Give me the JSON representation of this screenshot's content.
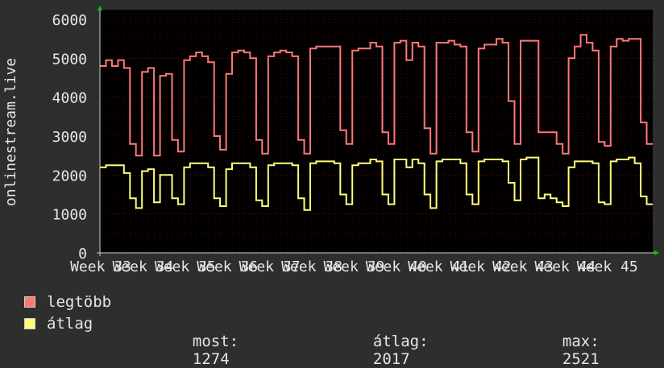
{
  "chart_data": {
    "type": "line",
    "ylabel": "onlinestream.live",
    "ylim": [
      0,
      6000
    ],
    "yticks": [
      0,
      1000,
      2000,
      3000,
      4000,
      5000,
      6000
    ],
    "xtick_labels": [
      "Week 33",
      "Week 34",
      "Week 35",
      "Week 36",
      "Week 37",
      "Week 38",
      "Week 39",
      "Week 40",
      "Week 41",
      "Week 42",
      "Week 43",
      "Week 44",
      "Week 45"
    ],
    "grid": true,
    "x_unit": "day",
    "colors": {
      "max": "#ff7878",
      "avg": "#ffff78",
      "grid": "#cc0000",
      "background": "#2e2e2e",
      "plot_bg": "#000000"
    },
    "series": [
      {
        "name": "legtöbb",
        "color": "#ff7878",
        "values": [
          4800,
          4950,
          4800,
          4950,
          4750,
          2800,
          2500,
          4650,
          4750,
          2500,
          4550,
          4600,
          2900,
          2600,
          4950,
          5050,
          5150,
          5050,
          4900,
          3000,
          2650,
          4600,
          5150,
          5200,
          5150,
          5000,
          2900,
          2550,
          5050,
          5150,
          5200,
          5150,
          5050,
          2900,
          2550,
          5250,
          5300,
          5300,
          5300,
          5300,
          3150,
          2800,
          5200,
          5250,
          5250,
          5400,
          5300,
          3100,
          2800,
          5400,
          5450,
          4950,
          5400,
          5300,
          3200,
          2550,
          5400,
          5400,
          5450,
          5350,
          5300,
          3100,
          2600,
          5250,
          5350,
          5350,
          5500,
          5400,
          3900,
          2800,
          5450,
          5450,
          5450,
          3100,
          3100,
          3100,
          2800,
          2550,
          5000,
          5300,
          5600,
          5400,
          5200,
          2850,
          2750,
          5300,
          5500,
          5450,
          5500,
          5500,
          3350,
          2800
        ]
      },
      {
        "name": "átlag",
        "color": "#ffff78",
        "values": [
          2200,
          2250,
          2250,
          2250,
          2050,
          1400,
          1150,
          2100,
          2150,
          1300,
          2000,
          2000,
          1400,
          1250,
          2200,
          2300,
          2300,
          2300,
          2200,
          1400,
          1200,
          2150,
          2300,
          2300,
          2300,
          2200,
          1350,
          1200,
          2250,
          2300,
          2300,
          2300,
          2250,
          1400,
          1100,
          2300,
          2350,
          2350,
          2350,
          2300,
          1500,
          1250,
          2250,
          2300,
          2300,
          2400,
          2350,
          1500,
          1250,
          2400,
          2400,
          2200,
          2400,
          2300,
          1500,
          1150,
          2350,
          2400,
          2400,
          2400,
          2300,
          1500,
          1250,
          2350,
          2400,
          2400,
          2400,
          2350,
          1800,
          1350,
          2400,
          2450,
          2450,
          1400,
          1500,
          1400,
          1300,
          1200,
          2200,
          2350,
          2350,
          2350,
          2300,
          1300,
          1250,
          2350,
          2400,
          2400,
          2450,
          2300,
          1450,
          1250
        ]
      }
    ]
  },
  "legend": {
    "max_label": "legtöbb",
    "avg_label": "átlag",
    "now_label": "most:",
    "now_value": "1274",
    "avg_stat_label": "átlag:",
    "avg_value": "2017",
    "max_stat_label": "max:",
    "max_value": "2521"
  }
}
